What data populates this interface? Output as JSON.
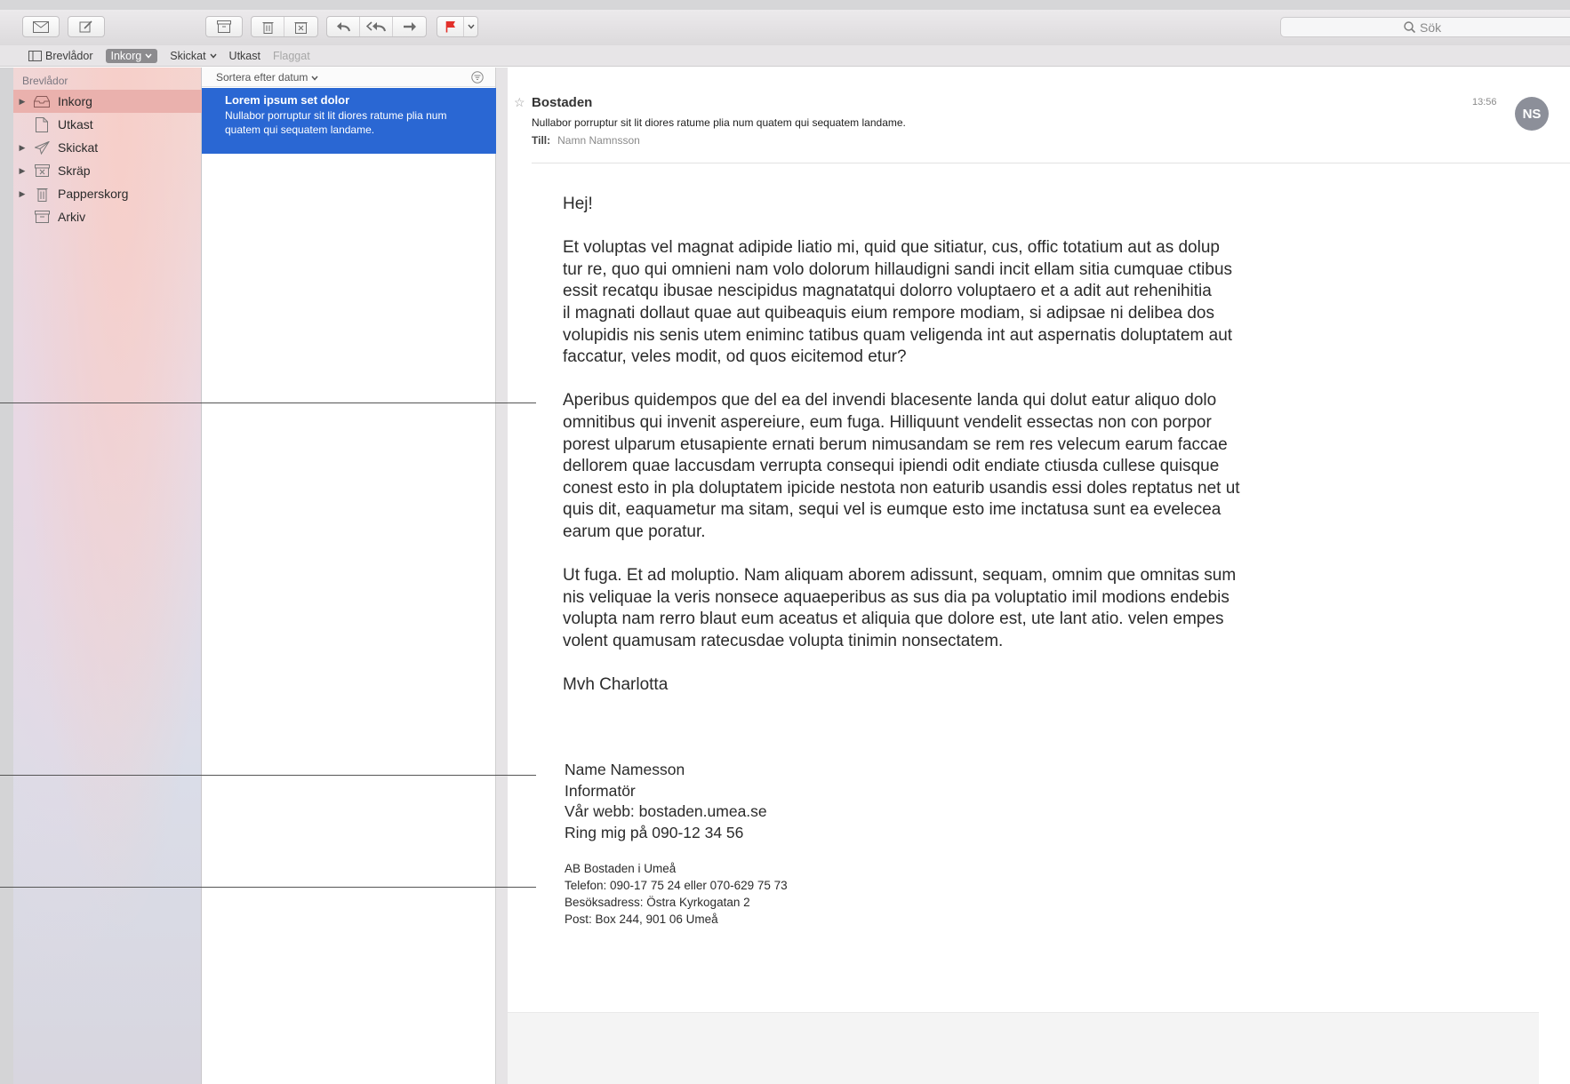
{
  "toolbar": {
    "buttons": [
      "get-mail-icon",
      "compose-icon",
      "archive-icon",
      "trash-icon",
      "junk-icon",
      "reply-icon",
      "reply-all-icon",
      "forward-icon",
      "flag-icon"
    ],
    "flag_color": "#e2302a",
    "search_placeholder": "Sök"
  },
  "favorites": {
    "mailboxes": "Brevlådor",
    "inbox": "Inkorg",
    "sent": "Skickat",
    "drafts": "Utkast",
    "flagged": "Flaggat"
  },
  "sidebar": {
    "header": "Brevlådor",
    "items": [
      {
        "label": "Inkorg",
        "icon": "inbox-icon",
        "expandable": true,
        "selected": true
      },
      {
        "label": "Utkast",
        "icon": "draft-icon",
        "expandable": false,
        "selected": false
      },
      {
        "label": "Skickat",
        "icon": "sent-icon",
        "expandable": true,
        "selected": false
      },
      {
        "label": "Skräp",
        "icon": "junk-icon",
        "expandable": true,
        "selected": false
      },
      {
        "label": "Papperskorg",
        "icon": "trash-icon",
        "expandable": true,
        "selected": false
      },
      {
        "label": "Arkiv",
        "icon": "archive-icon",
        "expandable": false,
        "selected": false
      }
    ],
    "selected_color": "#eab1ad"
  },
  "message_list": {
    "sort_label": "Sortera efter datum",
    "items": [
      {
        "subject": "Lorem ipsum set dolor",
        "preview": "Nullabor porruptur sit lit diores ratume plia num quatem qui sequatem landame.",
        "selected": true
      }
    ],
    "selected_color": "#2a67d3"
  },
  "message": {
    "sender": "Bostaden",
    "subject": "Nullabor porruptur sit lit diores ratume plia num quatem qui sequatem landame.",
    "to_label": "Till:",
    "to": "Namn Namnsson",
    "time": "13:56",
    "avatar_initials": "NS",
    "greeting": "Hej!",
    "paragraphs": [
      "Et voluptas vel magnat adipide liatio mi, quid que sitiatur, cus, offic totatium aut as dolup\ntur re, quo qui omnieni nam volo dolorum hillaudigni sandi incit ellam sitia cumquae ctibus\nessit recatqu ibusae nescipidus magnatatqui dolorro voluptaero et a adit aut rehenihitia\nil magnati dollaut quae aut quibeaquis eium rempore modiam, si adipsae ni delibea dos\nvolupidis nis senis utem eniminc tatibus quam veligenda int aut aspernatis doluptatem aut\nfaccatur, veles modit, od quos eicitemod etur?",
      "Aperibus quidempos que del ea del invendi blacesente landa qui dolut eatur aliquo dolo\nomnitibus qui invenit aspereiure, eum fuga. Hilliquunt vendelit essectas non con porpor\nporest ulparum etusapiente ernati berum nimusandam se rem res velecum earum faccae\ndellorem quae laccusdam verrupta consequi ipiendi odit endiate ctiusda cullese quisque\nconest esto in pla doluptatem ipicide nestota non eaturib usandis essi doles reptatus net ut\nquis dit, eaquametur ma sitam, sequi vel is eumque esto ime inctatusa sunt ea evelecea\nearum que poratur.",
      "Ut fuga. Et ad moluptio. Nam aliquam aborem adissunt, sequam, omnim que omnitas sum\nnis veliquae la veris nonsece aquaeperibus as sus dia pa voluptatio imil modions endebis\nvolupta nam rerro blaut eum aceatus et aliquia que dolore est, ute lant atio. velen empes\nvolent quamusam ratecusdae volupta tinimin nonsectatem."
    ],
    "closing": "Mvh Charlotta",
    "signature": "Name Namesson\nInformatör\nVår webb: bostaden.umea.se\nRing mig på 090-12 34 56",
    "company": "AB Bostaden i Umeå\nTelefon: 090-17 75 24 eller 070-629 75 73\nBesöksadress: Östra Kyrkogatan 2\nPost: Box 244, 901 06 Umeå"
  }
}
